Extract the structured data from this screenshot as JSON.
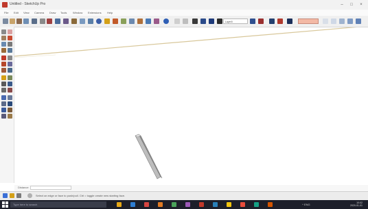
{
  "window": {
    "title": "Untitled - SketchUp Pro",
    "controls": {
      "minimize": "–",
      "maximize": "□",
      "close": "×"
    }
  },
  "menu": {
    "items": [
      "File",
      "Edit",
      "View",
      "Camera",
      "Draw",
      "Tools",
      "Window",
      "Extensions",
      "Help"
    ]
  },
  "toolbar": {
    "layer_value": "Layer0",
    "accent_color": "#3b6fd6",
    "style_color": "#f3b9a5"
  },
  "palette": {
    "icons": [
      "select-icon",
      "eraser-icon",
      "paint-bucket-icon",
      "line-icon",
      "rectangle-icon",
      "circle-icon",
      "arc-icon",
      "polygon-icon",
      "push-pull-icon",
      "move-icon",
      "rotate-icon",
      "scale-icon",
      "offset-icon",
      "follow-me-icon",
      "tape-measure-icon",
      "protractor-icon",
      "text-icon",
      "axes-icon",
      "dimension-icon",
      "section-plane-icon",
      "orbit-icon",
      "pan-icon",
      "zoom-icon",
      "zoom-window-icon",
      "zoom-extents-icon",
      "walk-icon",
      "look-around-icon",
      "position-camera-icon"
    ]
  },
  "viewport": {
    "background": "#ffffff",
    "horizon_color": "#d8c79a",
    "model_color": "#9a9a9a"
  },
  "measurements": {
    "label": "Distance"
  },
  "status": {
    "text": "Select an edge or face to push/pull. Ctrl = toggle create new starting face."
  },
  "taskbar": {
    "search_placeholder": "Type here to search",
    "tray_text": "^ ENG",
    "time": "10:02",
    "date": "2020-01-01",
    "colors": [
      "#e6a817",
      "#2d7dd2",
      "#d64541",
      "#e07a24",
      "#4aa35a",
      "#9b59b6",
      "#c0392b",
      "#2980b9",
      "#f1c40f",
      "#e74c3c",
      "#16a085",
      "#d35400"
    ]
  }
}
